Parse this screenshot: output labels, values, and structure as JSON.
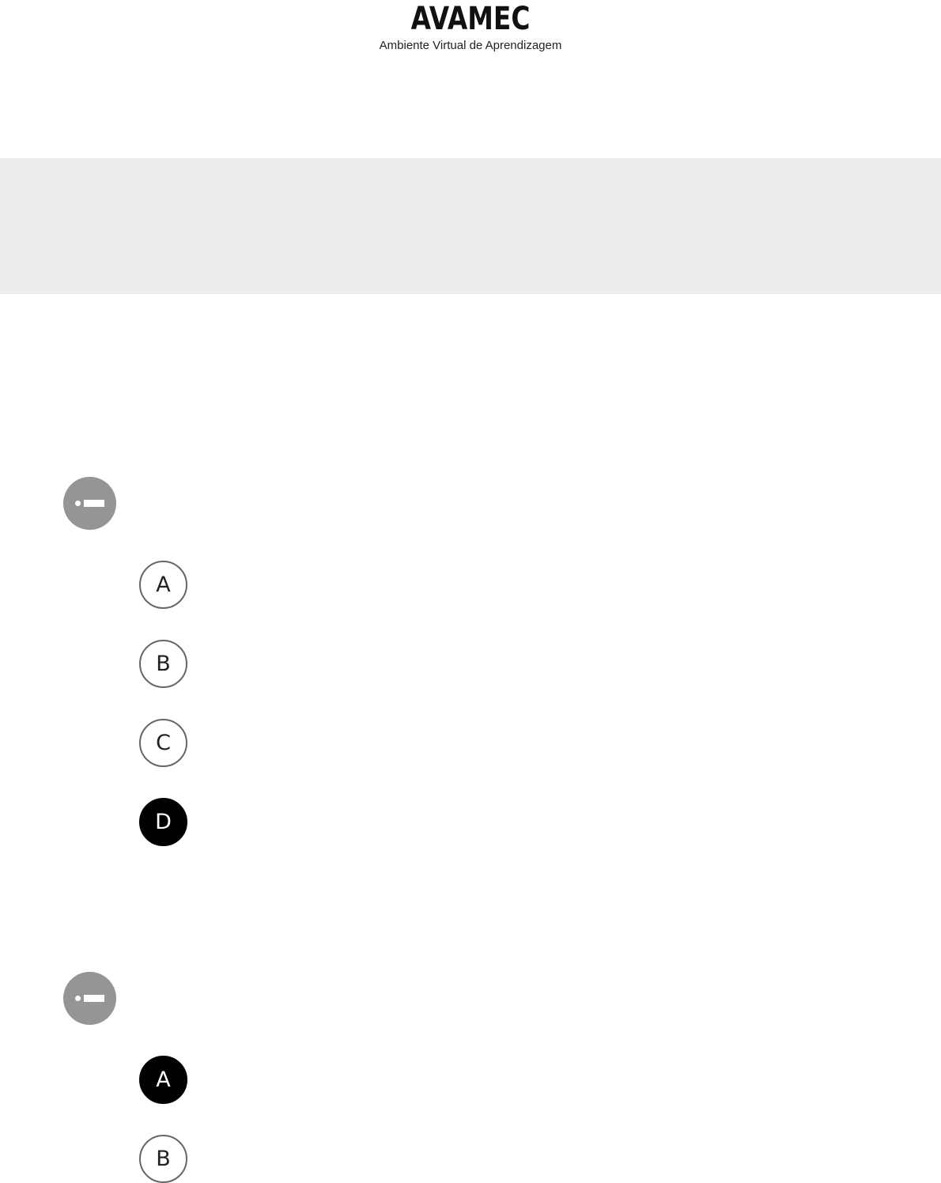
{
  "header": {
    "logo_text": "AVAMEC",
    "subtitle": "Ambiente Virtual de Aprendizagem"
  },
  "questions": [
    {
      "marker_icon": "dot-dash-icon",
      "options": [
        {
          "label": "A",
          "selected": false
        },
        {
          "label": "B",
          "selected": false
        },
        {
          "label": "C",
          "selected": false
        },
        {
          "label": "D",
          "selected": true
        }
      ]
    },
    {
      "marker_icon": "dot-dash-icon",
      "options": [
        {
          "label": "A",
          "selected": true
        },
        {
          "label": "B",
          "selected": false
        }
      ]
    }
  ],
  "colors": {
    "banner": "#ededed",
    "marker": "#959595",
    "selected": "#000000"
  }
}
